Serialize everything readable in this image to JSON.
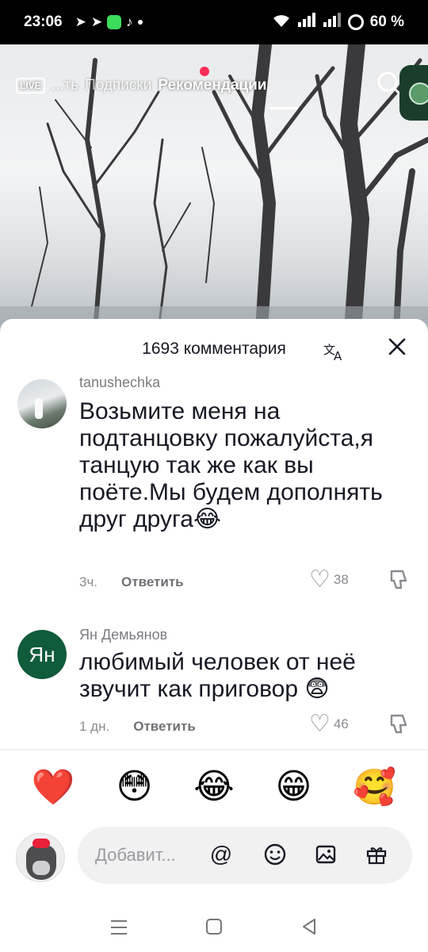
{
  "status_bar": {
    "time": "23:06",
    "battery": "60 %",
    "icons": [
      "telegram-icon",
      "telegram-icon",
      "messenger-app-icon",
      "tiktok-icon",
      "dot-icon",
      "wifi-icon",
      "signal-icon",
      "signal-icon",
      "battery-icon"
    ]
  },
  "top_nav": {
    "live_label": "LIVE",
    "tabs": [
      "...ть",
      "Подписки",
      "Рекомендации"
    ],
    "active_tab": "Рекомендации"
  },
  "comments_sheet": {
    "title": "1693 комментария",
    "comments": [
      {
        "username": "tanushechka",
        "text": "Возьмите меня на подтанцовку пожалуйста,я танцую так же как вы поёте.Мы будем дополнять друг друга😂",
        "time": "3ч.",
        "reply_label": "Ответить",
        "likes": "38"
      },
      {
        "username": "Ян Демьянов",
        "avatar_initials": "Ян",
        "text": "любимый человек от неё звучит как приговор 😨",
        "time": "1 дн.",
        "reply_label": "Ответить",
        "likes": "46"
      }
    ],
    "quick_emojis": [
      "❤️",
      "😳",
      "😂",
      "😁",
      "🥰"
    ],
    "input": {
      "placeholder": "Добавит..."
    }
  },
  "colors": {
    "accent_red": "#ff2d55",
    "avatar_green": "#0f5b3a",
    "text_primary": "#161823",
    "text_secondary": "#8a8b91"
  }
}
